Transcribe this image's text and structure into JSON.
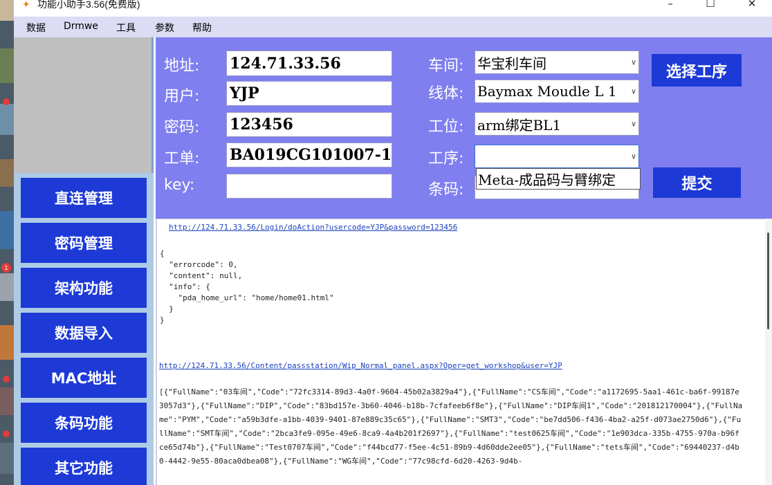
{
  "window": {
    "title": "功能小助手3.56(免费版)",
    "minimize": "–",
    "maximize": "☐",
    "close": "✕"
  },
  "desktop": {
    "badge_count": "1"
  },
  "menu": [
    "数据",
    "Drmwe",
    "工具",
    "参数",
    "帮助"
  ],
  "nav": [
    "直连管理",
    "密码管理",
    "架构功能",
    "数据导入",
    "MAC地址",
    "条码功能",
    "其它功能"
  ],
  "form": {
    "address_label": "地址:",
    "address_value": "124.71.33.56",
    "user_label": "用户:",
    "user_value": "YJP",
    "password_label": "密码:",
    "password_value": "123456",
    "order_label": "工单:",
    "order_value": "BA019CG101007-1",
    "key_label": "key:",
    "key_value": "",
    "workshop_label": "车间:",
    "workshop_value": "华宝利车间",
    "line_label": "线体:",
    "line_value": "Baymax Moudle L 1",
    "station_label": "工位:",
    "station_value": "arm绑定BL1",
    "process_label": "工序:",
    "process_value": "",
    "process_option": "Meta-成品码与臂绑定",
    "barcode_label": "条码:",
    "select_process_button": "选择工序",
    "submit_button": "提交"
  },
  "output": {
    "link1": "http://124.71.33.56/Login/doAction?usercode=YJP&password=123456",
    "json_response": "{\n  \"errorcode\": 0,\n  \"content\": null,\n  \"info\": {\n    \"pda_home_url\": \"home/home01.html\"\n  }\n}",
    "link2": "http://124.71.33.56/Content/passstation/Wip_Normal_panel.aspx?Oper=get_workshop&user=YJP",
    "workshop_list": "[{\"FullName\":\"03车间\",\"Code\":\"72fc3314-89d3-4a0f-9604-45b02a3829a4\"},{\"FullName\":\"CS车间\",\"Code\":\"a1172695-5aa1-461c-ba6f-99187e3057d3\"},{\"FullName\":\"DIP\",\"Code\":\"83bd157e-3b60-4046-b18b-7cfafeeb6f8e\"},{\"FullName\":\"DIP车间1\",\"Code\":\"201812170004\"},{\"FullName\":\"PYM\",\"Code\":\"a59b3dfe-a1bb-4039-9401-87e889c35c65\"},{\"FullName\":\"SMT3\",\"Code\":\"be7dd506-f436-4ba2-a25f-d073ae2750d6\"},{\"FullName\":\"SMT车间\",\"Code\":\"2bca3fe9-095e-49e6-8ca9-4a4b201f2697\"},{\"FullName\":\"test0625车间\",\"Code\":\"1e903dca-335b-4755-970a-b96fce65d74b\"},{\"FullName\":\"Test0707车间\",\"Code\":\"f44bcd77-f5ee-4c51-89b9-4d60dde2ee05\"},{\"FullName\":\"tets车间\",\"Code\":\"69440237-d4b0-4442-9e55-80aca0dbea08\"},{\"FullName\":\"WG车间\",\"Code\":\"77c98cfd-6d20-4263-9d4b-"
  }
}
